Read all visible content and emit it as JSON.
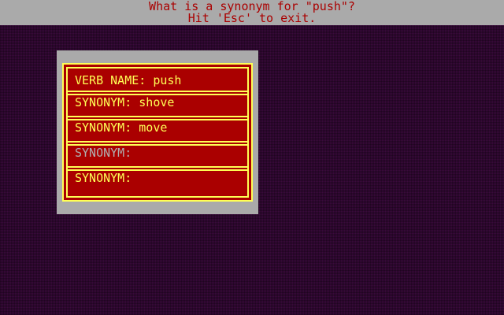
{
  "prompt": {
    "line1": "What is a synonym for \"push\"?",
    "line2": "Hit 'Esc' to exit."
  },
  "dialog": {
    "rows": [
      {
        "label": "VERB NAME:",
        "value": "push"
      },
      {
        "label": "SYNONYM:",
        "value": "shove"
      },
      {
        "label": "SYNONYM:",
        "value": "move"
      },
      {
        "label": "SYNONYM:",
        "value": ""
      },
      {
        "label": "SYNONYM:",
        "value": ""
      }
    ]
  },
  "colors": {
    "background": "#3a0a3c",
    "frame": "#aaaaaa",
    "panel": "#aa0000",
    "text": "#ffff55",
    "active_field_text": "#b0b0b0"
  }
}
